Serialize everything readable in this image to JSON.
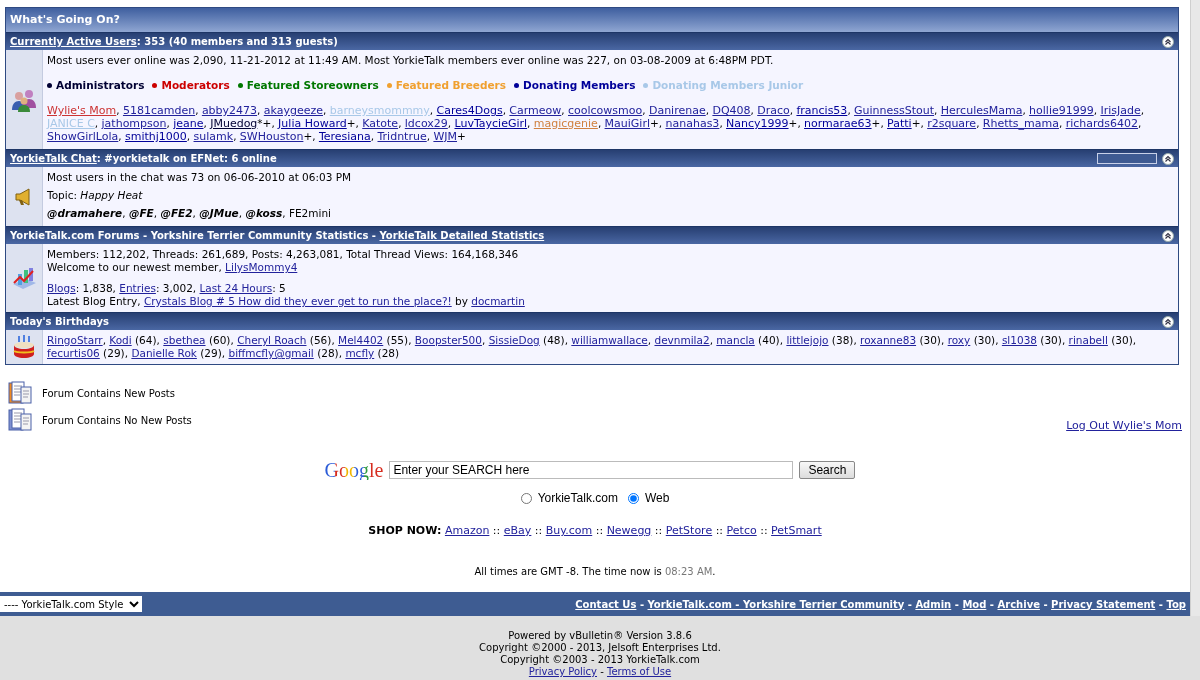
{
  "title": "What's Going On?",
  "sections": [
    {
      "kind": "users",
      "header": [
        {
          "text": "Currently Active Users",
          "kind": "link"
        },
        {
          "text": ": 353 (40 members and 313 guests)",
          "kind": "text"
        }
      ],
      "record": "Most users ever online was 2,090, 11-21-2012 at 11:49 AM. Most YorkieTalk members ever online was 227, on 03-08-2009 at 6:48PM PDT.",
      "legend": [
        {
          "label": "Administrators",
          "color": "#000033"
        },
        {
          "label": "Moderators",
          "color": "#cc0000"
        },
        {
          "label": "Featured Storeowners",
          "color": "#007700"
        },
        {
          "label": "Featured Breeders",
          "color": "#f0a030"
        },
        {
          "label": "Donating Members",
          "color": "#000099"
        },
        {
          "label": "Donating Members Junior",
          "color": "#a8c8e8"
        }
      ],
      "separator": ", ",
      "users": [
        {
          "name": "Wylie's Mom",
          "color": "#cc3333"
        },
        {
          "name": "5181camden",
          "color": "#22229c"
        },
        {
          "name": "abby2473",
          "color": "#22229c"
        },
        {
          "name": "akaygeeze",
          "color": "#22229c"
        },
        {
          "name": "barneysmommmy",
          "color": "#a8c8e8"
        },
        {
          "name": "Cares4Dogs",
          "color": "#000099"
        },
        {
          "name": "Carmeow",
          "color": "#22229c"
        },
        {
          "name": "coolcowsmoo",
          "color": "#22229c"
        },
        {
          "name": "Danirenae",
          "color": "#22229c"
        },
        {
          "name": "DQ408",
          "color": "#22229c"
        },
        {
          "name": "Draco",
          "color": "#22229c"
        },
        {
          "name": "francis53",
          "color": "#000099"
        },
        {
          "name": "GuinnessStout",
          "color": "#22229c"
        },
        {
          "name": "HerculesMama",
          "color": "#22229c"
        },
        {
          "name": "hollie91999",
          "color": "#22229c"
        },
        {
          "name": "IrisJade",
          "color": "#22229c"
        },
        {
          "name": "JANICE C",
          "color": "#a8c8e8"
        },
        {
          "name": "jathompson",
          "color": "#22229c"
        },
        {
          "name": "jeane",
          "color": "#000099"
        },
        {
          "name": "JMuedog",
          "color": "#000033",
          "marks": "*+"
        },
        {
          "name": "Julia Howard",
          "color": "#000099",
          "marks": "+"
        },
        {
          "name": "Katote",
          "color": "#22229c"
        },
        {
          "name": "ldcox29",
          "color": "#22229c"
        },
        {
          "name": "LuvTaycieGirl",
          "color": "#000099"
        },
        {
          "name": "magicgenie",
          "color": "#d08040"
        },
        {
          "name": "MauiGirl",
          "color": "#22229c",
          "marks": "+"
        },
        {
          "name": "nanahas3",
          "color": "#22229c"
        },
        {
          "name": "Nancy1999",
          "color": "#000099",
          "marks": "+"
        },
        {
          "name": "normarae63",
          "color": "#000099",
          "marks": "+"
        },
        {
          "name": "Patti",
          "color": "#000099",
          "marks": "+"
        },
        {
          "name": "r2square",
          "color": "#22229c"
        },
        {
          "name": "Rhetts_mama",
          "color": "#22229c"
        },
        {
          "name": "richards6402",
          "color": "#22229c"
        },
        {
          "name": "ShowGirlLola",
          "color": "#22229c"
        },
        {
          "name": "smithj1000",
          "color": "#000099"
        },
        {
          "name": "sulamk",
          "color": "#22229c"
        },
        {
          "name": "SWHouston",
          "color": "#22229c",
          "marks": "+"
        },
        {
          "name": "Teresiana",
          "color": "#000099"
        },
        {
          "name": "Tridntrue",
          "color": "#22229c"
        },
        {
          "name": "WJM",
          "color": "#22229c",
          "marks": "+"
        }
      ]
    },
    {
      "kind": "chat",
      "header": [
        {
          "text": "YorkieTalk Chat",
          "kind": "link"
        },
        {
          "text": ": #yorkietalk on EFNet: 6 online",
          "kind": "text"
        }
      ],
      "record": "Most users in the chat was 73 on 06-06-2010 at 06:03 PM",
      "topic_label": "Topic:",
      "topic": "Happy Heat",
      "separator": ", ",
      "chatters": [
        {
          "name": "@dramahere",
          "kind": "op"
        },
        {
          "name": "@FE",
          "kind": "op"
        },
        {
          "name": "@FE2",
          "kind": "op"
        },
        {
          "name": "@JMue",
          "kind": "op"
        },
        {
          "name": "@koss",
          "kind": "op"
        },
        {
          "name": "FE2mini",
          "kind": "plain"
        }
      ]
    },
    {
      "kind": "stats",
      "header": [
        {
          "text": "YorkieTalk.com Forums - Yorkshire Terrier Community Statistics - ",
          "kind": "text"
        },
        {
          "text": "YorkieTalk Detailed Statistics",
          "kind": "link"
        }
      ],
      "groups": [
        [
          [
            {
              "text": "Members: 112,202, Threads: 261,689, Posts: 4,263,081, Total Thread Views: 164,168,346",
              "kind": "text"
            }
          ],
          [
            {
              "text": "Welcome to our newest member, ",
              "kind": "text"
            },
            {
              "text": "LilysMommy4",
              "kind": "link"
            }
          ]
        ],
        [
          [
            {
              "text": "Blogs",
              "kind": "link"
            },
            {
              "text": ": 1,838, ",
              "kind": "text"
            },
            {
              "text": "Entries",
              "kind": "link"
            },
            {
              "text": ": 3,002, ",
              "kind": "text"
            },
            {
              "text": "Last 24 Hours",
              "kind": "link"
            },
            {
              "text": ": 5",
              "kind": "text"
            }
          ],
          [
            {
              "text": "Latest Blog Entry, ",
              "kind": "text"
            },
            {
              "text": "Crystals Blog # 5 How did they ever get to run the place?!",
              "kind": "link"
            },
            {
              "text": " by ",
              "kind": "text"
            },
            {
              "text": "docmartin",
              "kind": "link"
            }
          ]
        ]
      ]
    },
    {
      "kind": "birthdays",
      "header": [
        {
          "text": "Today's Birthdays",
          "kind": "text"
        }
      ],
      "separator": ", ",
      "people": [
        {
          "name": "RingoStarr"
        },
        {
          "name": "Kodi",
          "age": "(64)"
        },
        {
          "name": "sbethea",
          "age": "(60)"
        },
        {
          "name": "Cheryl Roach",
          "age": "(56)"
        },
        {
          "name": "Mel4402",
          "age": "(55)"
        },
        {
          "name": "Boopster500"
        },
        {
          "name": "SissieDog",
          "age": "(48)"
        },
        {
          "name": "williamwallace"
        },
        {
          "name": "devnmila2"
        },
        {
          "name": "mancla",
          "age": "(40)"
        },
        {
          "name": "littlejojo",
          "age": "(38)"
        },
        {
          "name": "roxanne83",
          "age": "(30)"
        },
        {
          "name": "roxy",
          "age": "(30)"
        },
        {
          "name": "sl1038",
          "age": "(30)"
        },
        {
          "name": "rinabell",
          "age": "(30)"
        },
        {
          "name": "fecurtis06",
          "age": "(29)"
        },
        {
          "name": "Danielle Rok",
          "age": "(29)"
        },
        {
          "name": "biffmcfly@gmail",
          "age": "(28)"
        },
        {
          "name": "mcfly",
          "age": "(28)"
        }
      ]
    }
  ],
  "forum_legend": [
    {
      "kind": "new",
      "label": "Forum Contains New Posts"
    },
    {
      "kind": "old",
      "label": "Forum Contains No New Posts"
    }
  ],
  "logout": "Log Out Wylie's Mom",
  "search": {
    "logo": "Google",
    "value": "Enter your SEARCH here",
    "button": "Search",
    "options": [
      {
        "label": "YorkieTalk.com",
        "selected": false
      },
      {
        "label": "Web",
        "selected": true
      }
    ]
  },
  "shop": {
    "label": "SHOP NOW:",
    "separator": "::",
    "links": [
      "Amazon",
      "eBay",
      "Buy.com",
      "Newegg",
      "PetStore",
      "Petco",
      "PetSmart"
    ]
  },
  "time": {
    "prefix": "All times are GMT -8. The time now is ",
    "time": "08:23 AM",
    "suffix": "."
  },
  "style_select": "---- YorkieTalk.com Style",
  "footer": {
    "separator": "-",
    "links": [
      "Contact Us",
      "YorkieTalk.com - Yorkshire Terrier Community",
      "Admin",
      "Mod",
      "Archive",
      "Privacy Statement",
      "Top"
    ]
  },
  "credits": [
    "Powered by vBulletin® Version 3.8.6",
    "Copyright ©2000 - 2013, Jelsoft Enterprises Ltd.",
    "Copyright ©2003 - 2013 YorkieTalk.com"
  ],
  "policy": {
    "separator": "-",
    "links": [
      "Privacy Policy",
      "Terms of Use"
    ]
  }
}
